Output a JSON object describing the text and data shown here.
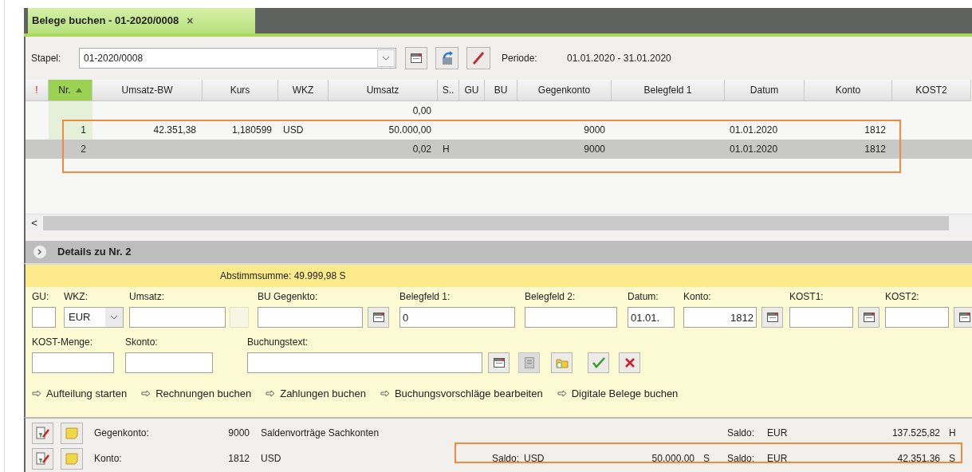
{
  "window": {
    "tab_title": "Belege buchen  - 01-2020/0008",
    "tab_close": "×"
  },
  "toolbar": {
    "stapel_label": "Stapel:",
    "stapel_value": "01-2020/0008",
    "periode_label": "Periode:",
    "periode_value": "01.01.2020 - 31.01.2020"
  },
  "table": {
    "columns": [
      {
        "label": "!",
        "sorted": false
      },
      {
        "label": "Nr.",
        "sorted": true
      },
      {
        "label": "Umsatz-BW",
        "sorted": false
      },
      {
        "label": "Kurs",
        "sorted": false
      },
      {
        "label": "WKZ",
        "sorted": false
      },
      {
        "label": "Umsatz",
        "sorted": false
      },
      {
        "label": "S..",
        "sorted": false
      },
      {
        "label": "GU",
        "sorted": false
      },
      {
        "label": "BU",
        "sorted": false
      },
      {
        "label": "Gegenkonto",
        "sorted": false
      },
      {
        "label": "Belegfeld 1",
        "sorted": false
      },
      {
        "label": "Datum",
        "sorted": false
      },
      {
        "label": "Konto",
        "sorted": false
      },
      {
        "label": "KOST2",
        "sorted": false
      }
    ],
    "rows": [
      {
        "selected": false,
        "cells": [
          null,
          null,
          null,
          null,
          null,
          "0,00",
          null,
          null,
          null,
          null,
          null,
          null,
          null,
          null
        ]
      },
      {
        "selected": false,
        "cells": [
          null,
          "1",
          "42.351,38",
          "1,180599",
          "USD",
          "50.000,00",
          null,
          null,
          null,
          "9000",
          null,
          "01.01.2020",
          "1812",
          null
        ]
      },
      {
        "selected": true,
        "cells": [
          null,
          "2",
          null,
          null,
          null,
          "0,02",
          "H",
          null,
          null,
          "9000",
          null,
          "01.01.2020",
          "1812",
          null
        ]
      }
    ],
    "scroll_left": "<"
  },
  "details": {
    "title": "Details zu Nr. 2",
    "expanded": false,
    "sum": "Abstimmsumme: 49.999,98 S",
    "fields_row1": [
      {
        "kind": "text",
        "label": "GU:"
      },
      {
        "kind": "combo",
        "label": "WKZ:",
        "value": "EUR"
      },
      {
        "kind": "text",
        "label": "Umsatz:"
      },
      {
        "kind": "blank"
      },
      {
        "kind": "lookup",
        "label": "BU Gegenkto:"
      },
      {
        "kind": "text",
        "label": "Belegfeld 1:",
        "value": "0"
      },
      {
        "kind": "text",
        "label": "Belegfeld 2:"
      },
      {
        "kind": "text",
        "label": "Datum:",
        "value": "01.01."
      },
      {
        "kind": "lookup",
        "label": "Konto:",
        "value": "1812"
      },
      {
        "kind": "lookup",
        "label": "KOST1:"
      },
      {
        "kind": "lookup",
        "label": "KOST2:"
      }
    ],
    "fields_row2": [
      {
        "kind": "text",
        "label": "KOST-Menge:"
      },
      {
        "kind": "text",
        "label": "Skonto:"
      },
      {
        "kind": "text",
        "label": "Buchungstext:"
      }
    ],
    "actions": [
      {
        "kind": "calendar",
        "disabled": false
      },
      {
        "kind": "document",
        "disabled": true
      },
      {
        "kind": "folder",
        "disabled": false
      },
      {
        "kind": "ok",
        "disabled": false
      },
      {
        "kind": "cancel",
        "disabled": false
      }
    ],
    "links": [
      "Aufteilung starten",
      "Rechnungen buchen",
      "Zahlungen buchen",
      "Buchungsvorschläge bearbeiten",
      "Digitale Belege buchen"
    ]
  },
  "accounts": [
    {
      "label": "Gegenkonto:",
      "number": "9000",
      "name": "Saldenvorträge Sachkonten",
      "saldo_label": "Saldo:",
      "saldo_currency": "EUR",
      "saldo_amount": "137.525,82",
      "saldo_side": "H"
    },
    {
      "label": "Konto:",
      "number": "1812",
      "name": "USD",
      "fx_saldo_label": "Saldo:",
      "fx_saldo_currency": "USD",
      "fx_saldo_amount": "50.000,00",
      "fx_saldo_side": "S",
      "saldo_label": "Saldo:",
      "saldo_currency": "EUR",
      "saldo_amount": "42.351,36",
      "saldo_side": "S"
    }
  ]
}
